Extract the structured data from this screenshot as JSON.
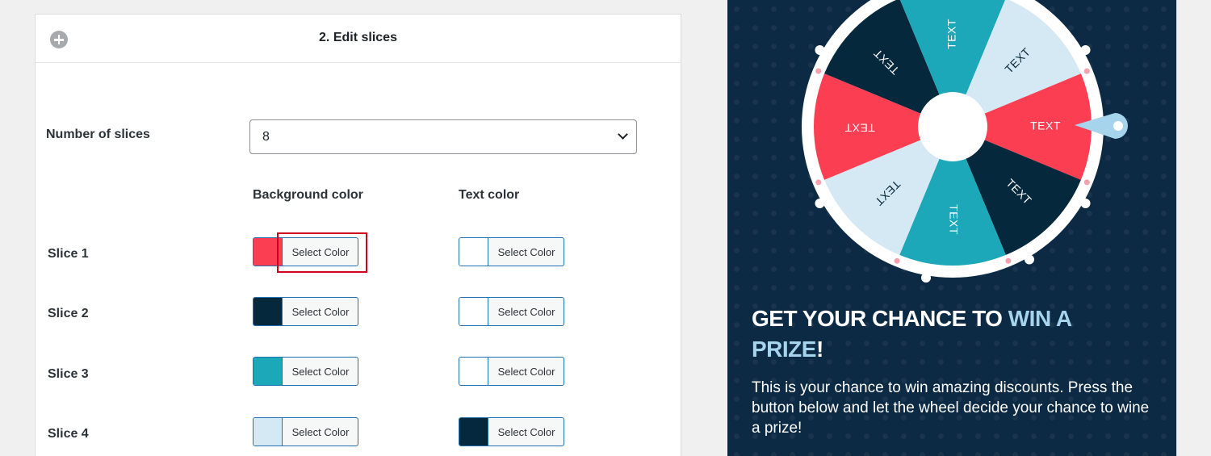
{
  "panel": {
    "title": "2. Edit slices",
    "number_of_slices_label": "Number of slices",
    "number_of_slices_value": "8",
    "background_color_header": "Background color",
    "text_color_header": "Text color",
    "select_color_label": "Select Color"
  },
  "slices": [
    {
      "label": "Slice 1",
      "background": "#fc3e52",
      "text": "#ffffff"
    },
    {
      "label": "Slice 2",
      "background": "#06283d",
      "text": "#ffffff"
    },
    {
      "label": "Slice 3",
      "background": "#1ca8b8",
      "text": "#ffffff"
    },
    {
      "label": "Slice 4",
      "background": "#d4e9f3",
      "text": "#06283d"
    }
  ],
  "preview": {
    "slice_text": "TEXT",
    "headline_part1": "GET YOUR CHANCE TO ",
    "headline_accent": "WIN A PRIZE",
    "headline_end": "!",
    "body": "This is your chance to win amazing discounts. Press the button below and let the wheel decide your chance to wine a prize!",
    "colors": {
      "background": "#0d2a45",
      "accent": "#a5d4ec",
      "pointer": "#a5d4ec"
    }
  }
}
